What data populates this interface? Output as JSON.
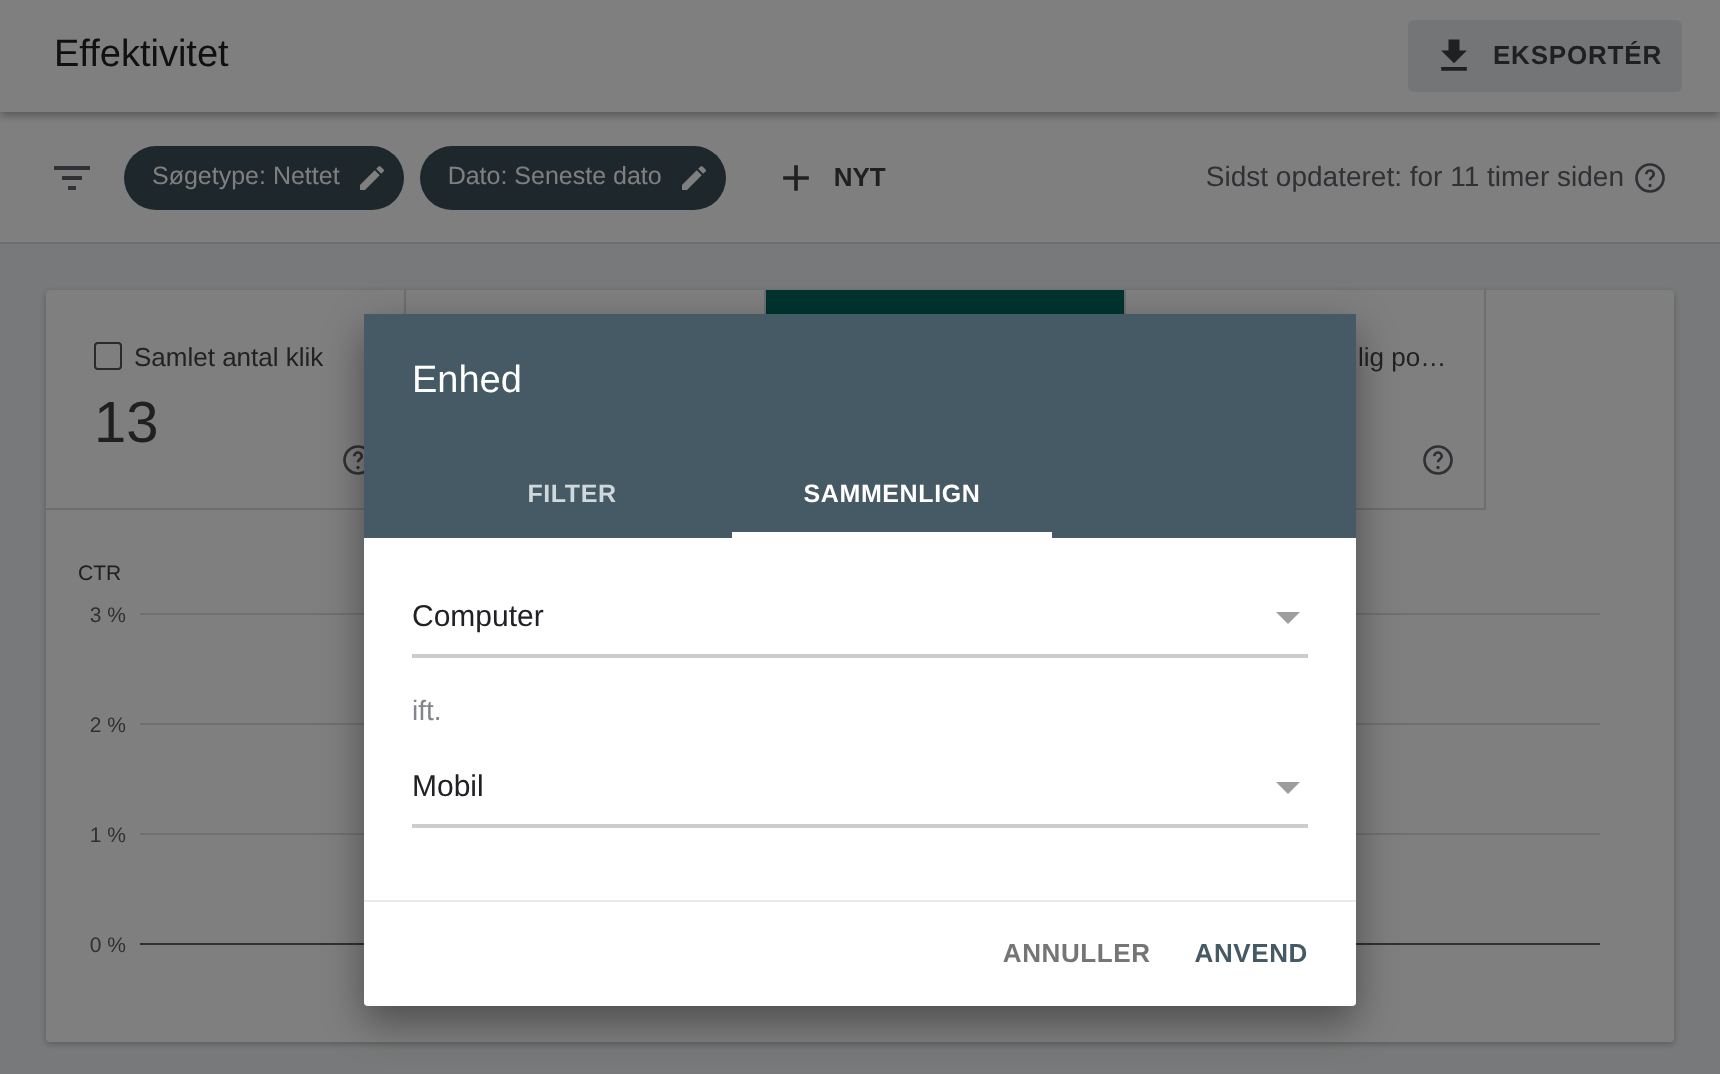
{
  "header": {
    "title": "Effektivitet",
    "export_button": "EKSPORTÉR"
  },
  "filters": {
    "chips": [
      {
        "label": "Søgetype: Nettet"
      },
      {
        "label": "Dato: Seneste dato"
      }
    ],
    "new_button": "NYT",
    "updated": "Sidst opdateret: for 11 timer siden"
  },
  "metrics": [
    {
      "kind": "full",
      "label": "Samlet antal klik",
      "value": "13",
      "checked": false,
      "selected": false
    },
    {
      "kind": "hidden",
      "selected": false
    },
    {
      "kind": "hidden",
      "selected": true
    },
    {
      "kind": "partial",
      "label": "lig po…",
      "selected": false
    }
  ],
  "chart": {
    "ylabel": "CTR",
    "yticks": [
      "3 %",
      "2 %",
      "1 %",
      "0 %"
    ]
  },
  "dialog": {
    "title": "Enhed",
    "tabs": [
      {
        "label": "FILTER",
        "selected": false
      },
      {
        "label": "SAMMENLIGN",
        "selected": true
      }
    ],
    "first_select": {
      "value": "Computer"
    },
    "between": "ift.",
    "second_select": {
      "value": "Mobil"
    },
    "buttons": [
      {
        "label": "ANNULLER",
        "kind": "cancel"
      },
      {
        "label": "ANVEND",
        "kind": "primary"
      }
    ]
  }
}
